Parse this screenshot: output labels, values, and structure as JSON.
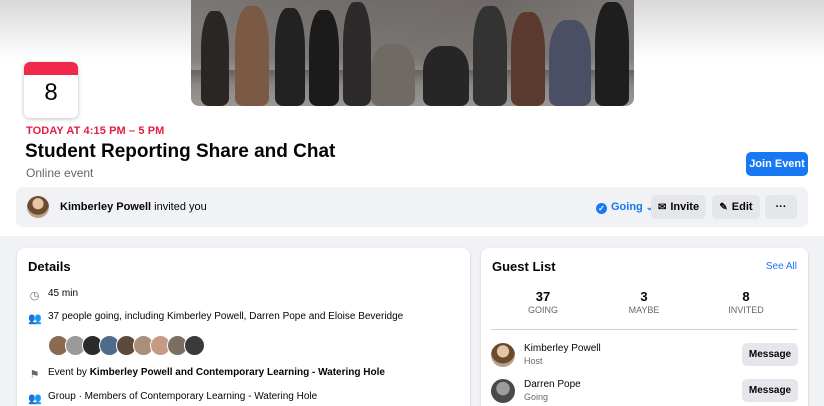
{
  "event": {
    "date_day": "8",
    "time": "TODAY AT 4:15 PM – 5 PM",
    "title": "Student Reporting Share and Chat",
    "type": "Online event",
    "join_label": "Join Event"
  },
  "invite_bar": {
    "inviter": "Kimberley Powell",
    "invited_text": " invited you",
    "going_label": "Going",
    "invite_label": "Invite",
    "edit_label": "Edit",
    "more_label": "···"
  },
  "details": {
    "heading": "Details",
    "duration": "45 min",
    "people_going": "37 people going, including Kimberley Powell, Darren Pope and Eloise Beveridge",
    "event_by_prefix": "Event by ",
    "event_by_hosts": "Kimberley Powell and Contemporary Learning - Watering Hole",
    "group_line": "Group · Members of Contemporary Learning - Watering Hole"
  },
  "guest_list": {
    "heading": "Guest List",
    "see_all": "See All",
    "stats": [
      {
        "count": "37",
        "label": "GOING"
      },
      {
        "count": "3",
        "label": "MAYBE"
      },
      {
        "count": "8",
        "label": "INVITED"
      }
    ],
    "guests": [
      {
        "name": "Kimberley Powell",
        "status": "Host",
        "action": "Message"
      },
      {
        "name": "Darren Pope",
        "status": "Going",
        "action": "Message"
      }
    ]
  },
  "colors": {
    "accent": "#1877f2",
    "date_red": "#e41e3f",
    "secondary_text": "#65676b",
    "button_grey": "#e4e6eb"
  },
  "icons": {
    "duration": "clock-icon",
    "people": "people-icon",
    "event_by": "flag-icon",
    "group": "group-icon",
    "invite": "envelope-icon",
    "edit": "pencil-icon",
    "going": "check-circle-icon"
  }
}
